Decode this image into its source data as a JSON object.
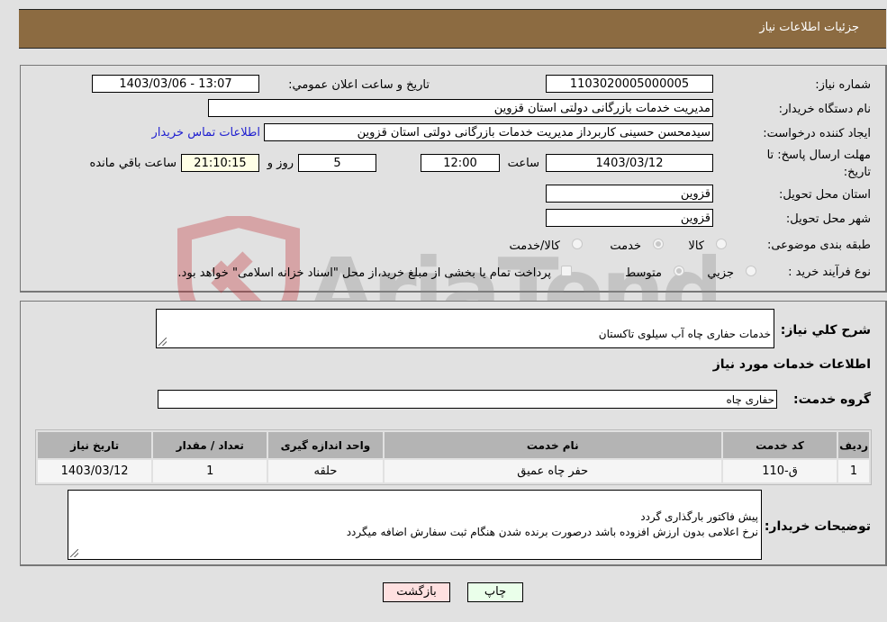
{
  "header": {
    "title": "جزئیات اطلاعات نیاز"
  },
  "details": {
    "need_number_label": "شماره نیاز:",
    "need_number": "1103020005000005",
    "announce_label": "تاریخ و ساعت اعلان عمومي:",
    "announce_value": "1403/03/06 - 13:07",
    "buyer_org_label": "نام دستگاه خریدار:",
    "buyer_org": "مدیریت خدمات بازرگانی دولتی استان قزوین",
    "creator_label": "ایجاد کننده درخواست:",
    "creator": "سیدمحسن  حسینی کاربرداز مدیریت خدمات بازرگانی دولتی استان قزوین",
    "contact_link": "اطلاعات تماس خریدار",
    "deadline_label": "مهلت ارسال پاسخ: تا تاریخ:",
    "deadline_date": "1403/03/12",
    "time_label": "ساعت",
    "deadline_time": "12:00",
    "days_value": "5",
    "days_label": "روز و",
    "remaining_time": "21:10:15",
    "remaining_label": "ساعت باقي مانده",
    "province_label": "استان محل تحویل:",
    "province": "قزوین",
    "city_label": "شهر محل تحویل:",
    "city": "قزوین",
    "category_label": "طبقه بندی موضوعی:",
    "category_options": [
      {
        "label": "کالا",
        "selected": false
      },
      {
        "label": "خدمت",
        "selected": true
      },
      {
        "label": "کالا/خدمت",
        "selected": false
      }
    ],
    "process_label": "نوع فرآیند خرید :",
    "process_options": [
      {
        "label": "جزيي",
        "selected": false
      },
      {
        "label": "متوسط",
        "selected": true
      }
    ],
    "treasury_checkbox_checked": false,
    "treasury_text": "پرداخت تمام یا بخشی از مبلغ خرید،از محل \"اسناد خزانه اسلامی\" خواهد بود."
  },
  "summary": {
    "general_desc_label": "شرح کلي نیاز:",
    "general_desc": "خدمات حفاری چاه آب سیلوی تاکستان",
    "services_info_title": "اطلاعات خدمات مورد نیاز",
    "service_group_label": "گروه خدمت:",
    "service_group": "حفاری چاه"
  },
  "table": {
    "headers": [
      "ردیف",
      "کد خدمت",
      "نام خدمت",
      "واحد اندازه گیری",
      "تعداد / مقدار",
      "تاریخ نیاز"
    ],
    "rows": [
      [
        "1",
        "ق-110",
        "حفر چاه عمیق",
        "حلقه",
        "1",
        "1403/03/12"
      ]
    ]
  },
  "buyer_notes": {
    "label": "توضیحات خریدار:",
    "text": "پیش فاکتور بارگذاری گردد\nنرخ اعلامی بدون ارزش افزوده باشد درصورت برنده شدن هنگام ثبت سفارش اضافه میگردد"
  },
  "buttons": {
    "print": "چاپ",
    "back": "بازگشت"
  },
  "watermark": {
    "text": "AriaTender.net"
  },
  "colors": {
    "header_bg": "#8c6b41",
    "print_bg": "#eaffea",
    "back_bg": "#ffe0e0",
    "link": "#2020d0"
  }
}
